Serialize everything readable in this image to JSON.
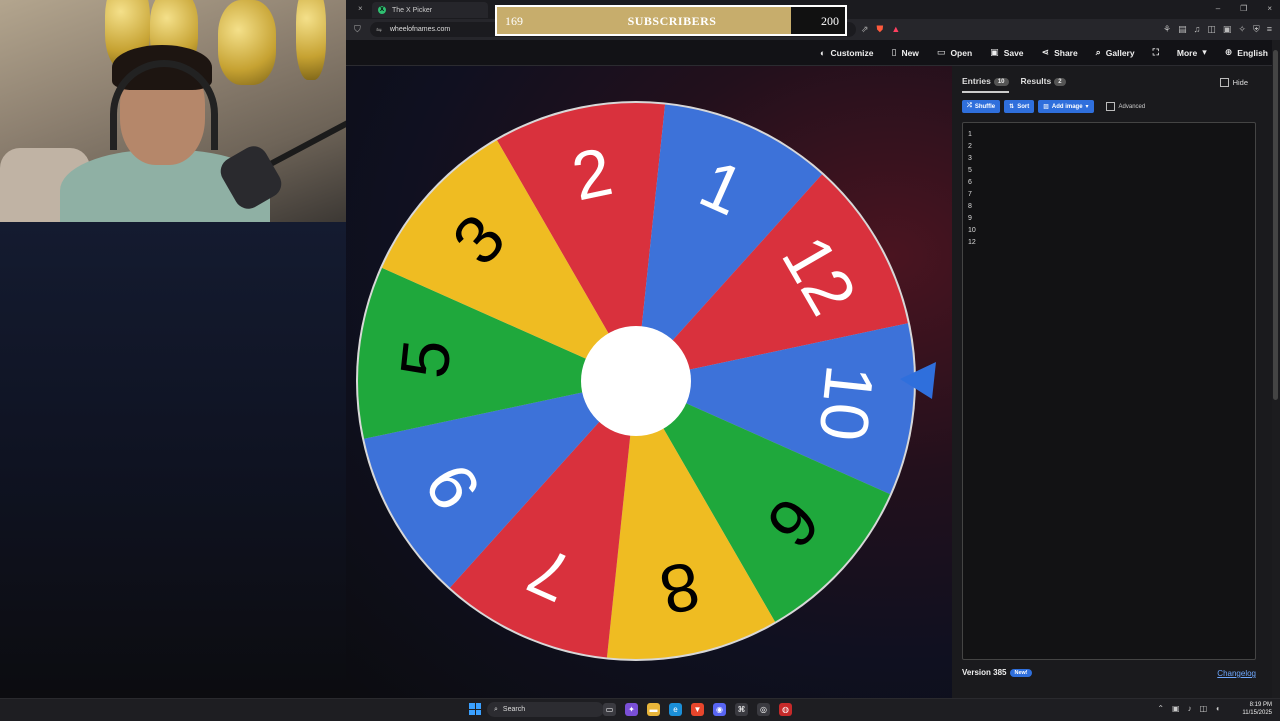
{
  "browser": {
    "tabs": [
      {
        "label": "",
        "close": "×"
      },
      {
        "label": "The X Picker",
        "icon": "X"
      }
    ],
    "window_controls": [
      "–",
      "❐",
      "×"
    ],
    "url": "wheelofnames.com"
  },
  "overlay": {
    "current": "169",
    "label": "SUBSCRIBERS",
    "goal": "200",
    "progress": 0.845
  },
  "app": {
    "menu": [
      {
        "label": "Customize",
        "icon": "palette-icon",
        "glyph": "◐"
      },
      {
        "label": "New",
        "icon": "file-icon",
        "glyph": "▯"
      },
      {
        "label": "Open",
        "icon": "folder-icon",
        "glyph": "▭"
      },
      {
        "label": "Save",
        "icon": "save-icon",
        "glyph": "▣"
      },
      {
        "label": "Share",
        "icon": "share-icon",
        "glyph": "⋖"
      },
      {
        "label": "Gallery",
        "icon": "search-icon",
        "glyph": "⌕"
      },
      {
        "label": "",
        "icon": "fullscreen-icon",
        "glyph": "⛶"
      },
      {
        "label": "More",
        "icon": "chevron-down-icon",
        "glyph": "▾"
      },
      {
        "label": "English",
        "icon": "globe-icon",
        "glyph": "⊕"
      }
    ]
  },
  "wheel": {
    "segments": [
      {
        "label": "2",
        "color": "#d9313d",
        "text_color": "#ffffff"
      },
      {
        "label": "1",
        "color": "#3d72d9",
        "text_color": "#ffffff"
      },
      {
        "label": "12",
        "color": "#d9313d",
        "text_color": "#ffffff"
      },
      {
        "label": "10",
        "color": "#3d72d9",
        "text_color": "#ffffff"
      },
      {
        "label": "6",
        "color": "#1fa83c",
        "text_color": "#000000"
      },
      {
        "label": "8",
        "color": "#efbc22",
        "text_color": "#000000"
      },
      {
        "label": "7",
        "color": "#d9313d",
        "text_color": "#ffffff"
      },
      {
        "label": "9",
        "color": "#3d72d9",
        "text_color": "#ffffff"
      },
      {
        "label": "5",
        "color": "#1fa83c",
        "text_color": "#000000"
      },
      {
        "label": "3",
        "color": "#efbc22",
        "text_color": "#000000"
      }
    ],
    "pointer_color": "#2f6fdc"
  },
  "panel": {
    "tabs": [
      {
        "label": "Entries",
        "count": "10"
      },
      {
        "label": "Results",
        "count": "2"
      }
    ],
    "hide_label": "Hide",
    "buttons": [
      {
        "label": "Shuffle",
        "glyph": "⤮"
      },
      {
        "label": "Sort",
        "glyph": "⇅"
      },
      {
        "label": "Add image",
        "glyph": "▨",
        "caret": "▾"
      }
    ],
    "advanced_label": "Advanced",
    "entries": [
      "1",
      "2",
      "3",
      "5",
      "6",
      "7",
      "8",
      "9",
      "10",
      "12"
    ],
    "version": "Version 385",
    "new_badge": "New!",
    "changelog": "Changelog"
  },
  "taskbar": {
    "search": "Search",
    "time": "8:19 PM",
    "date": "11/15/2025"
  }
}
